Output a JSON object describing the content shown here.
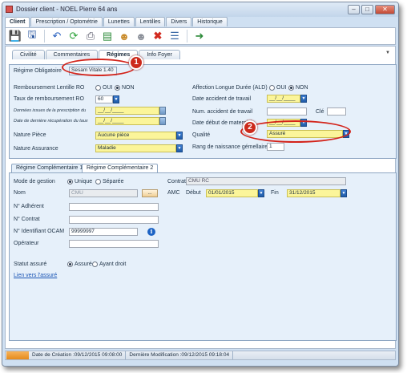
{
  "window": {
    "title": "Dossier client - NOEL Pierre 64 ans"
  },
  "top_tabs": [
    "Client",
    "Prescription / Optométrie",
    "Lunettes",
    "Lentilles",
    "Divers",
    "Historique"
  ],
  "sub_tabs": [
    "Civilité",
    "Commentaires",
    "Régimes",
    "Info Foyer"
  ],
  "regime_obligatoire": {
    "title": "Régime Obligatoire",
    "sesam_button": "Sesam Vitale 1.40",
    "remb_lentille_label": "Remboursement Lentille RO",
    "taux_label": "Taux de remboursement RO",
    "taux_value": "60",
    "donnees_label": "Données issues de la prescription du",
    "derniere_label": "Date de dernière récupération du taux",
    "date_placeholder": "__/__/____",
    "nature_piece_label": "Nature Pièce",
    "nature_piece_value": "Aucune pièce",
    "nature_assurance_label": "Nature Assurance",
    "nature_assurance_value": "Maladie",
    "ald_label": "Affection Longue Durée (ALD)",
    "date_accident_label": "Date accident de travail",
    "num_accident_label": "Num. accident de travail",
    "cle_label": "Clé",
    "maternite_label": "Date début de maternité",
    "qualite_label": "Qualité",
    "qualite_value": "Assuré",
    "rang_label": "Rang de naissance gémellaire",
    "rang_value": "1",
    "oui": "OUI",
    "non": "NON"
  },
  "complementaire": {
    "tab1": "Régime Complémentaire 1",
    "tab2": "Régime Complémentaire 2",
    "mode_label": "Mode de gestion",
    "unique": "Unique",
    "separee": "Séparée",
    "nom_label": "Nom",
    "nom_value": "CMU",
    "adherent_label": "N° Adhérent",
    "contrat_num_label": "N° Contrat",
    "ocam_label": "N° Identifiant OCAM",
    "ocam_value": "99999997",
    "operateur_label": "Opérateur",
    "contrat_label": "Contrat",
    "contrat_value": "CMU RC",
    "amc_label": "AMC",
    "debut_label": "Début",
    "debut_value": "01/01/2015",
    "fin_label": "Fin",
    "fin_value": "31/12/2015",
    "statut_label": "Statut assuré",
    "assure": "Assuré",
    "ayant_droit": "Ayant droit",
    "lien": "Lien vers l'assuré"
  },
  "annotations": [
    "1",
    "2"
  ],
  "status": {
    "creation": "Date de Création :09/12/2015 09:08:00",
    "modification": "Dernière Modification :09/12/2015 09:18:04"
  },
  "colors": {
    "accent": "#1f5ba7",
    "highlight": "#fbf59a",
    "annotation": "#cc2a1c"
  },
  "icons": [
    "save-icon",
    "save-close-icon",
    "undo-icon",
    "refresh-icon",
    "print-icon",
    "card-icon",
    "user-icon",
    "user-grey-icon",
    "delete-icon",
    "book-icon",
    "exit-icon"
  ]
}
